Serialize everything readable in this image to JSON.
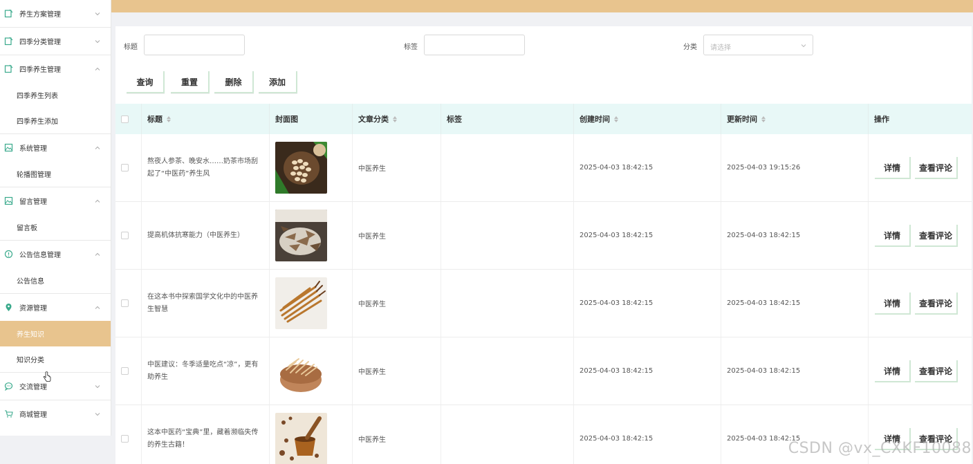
{
  "sidebar": {
    "groups": [
      {
        "label": "养生方案管理",
        "icon": "edit-doc-icon",
        "expanded": false,
        "items": []
      },
      {
        "label": "四季分类管理",
        "icon": "edit-doc-icon",
        "expanded": false,
        "items": []
      },
      {
        "label": "四季养生管理",
        "icon": "edit-doc-icon",
        "expanded": true,
        "items": [
          "四季养生列表",
          "四季养生添加"
        ]
      },
      {
        "label": "系统管理",
        "icon": "image-icon",
        "expanded": true,
        "items": [
          "轮播图管理"
        ]
      },
      {
        "label": "留言管理",
        "icon": "image-icon",
        "expanded": true,
        "items": [
          "留言板"
        ]
      },
      {
        "label": "公告信息管理",
        "icon": "info-icon",
        "expanded": true,
        "items": [
          "公告信息"
        ]
      },
      {
        "label": "资源管理",
        "icon": "location-pin-icon",
        "expanded": true,
        "items": [
          "养生知识",
          "知识分类"
        ]
      },
      {
        "label": "交流管理",
        "icon": "chat-icon",
        "expanded": false,
        "items": []
      },
      {
        "label": "商城管理",
        "icon": "cart-icon",
        "expanded": false,
        "items": []
      }
    ],
    "active_item": "养生知识"
  },
  "filters": {
    "title_label": "标题",
    "title_value": "",
    "tag_label": "标签",
    "tag_value": "",
    "category_label": "分类",
    "category_placeholder": "请选择"
  },
  "toolbar": {
    "search": "查询",
    "reset": "重置",
    "delete": "删除",
    "add": "添加"
  },
  "table": {
    "columns": {
      "title": "标题",
      "cover": "封面图",
      "category": "文章分类",
      "tags": "标签",
      "created": "创建时间",
      "updated": "更新时间",
      "actions": "操作"
    },
    "rows": [
      {
        "title": "熬夜人参茶、晚安水……奶茶市场刮起了“中医药”养生风",
        "category": "中医养生",
        "tags": "",
        "created": "2025-04-03 18:42:15",
        "updated": "2025-04-03 19:15:26",
        "cover": "peanuts"
      },
      {
        "title": "提高机体抗寒能力（中医养生）",
        "category": "中医养生",
        "tags": "",
        "created": "2025-04-03 18:42:15",
        "updated": "2025-04-03 18:42:15",
        "cover": "dried-herbs"
      },
      {
        "title": "在这本书中探索国学文化中的中医养生智慧",
        "category": "中医养生",
        "tags": "",
        "created": "2025-04-03 18:42:15",
        "updated": "2025-04-03 18:42:15",
        "cover": "cordyceps"
      },
      {
        "title": "中医建议：冬季适量吃点“凉”，更有助养生",
        "category": "中医养生",
        "tags": "",
        "created": "2025-04-03 18:42:15",
        "updated": "2025-04-03 18:42:15",
        "cover": "herb-bowl"
      },
      {
        "title": "这本中医药“宝典”里，藏着濒临失传的养生古籍！",
        "category": "中医养生",
        "tags": "",
        "created": "2025-04-03 18:42:15",
        "updated": "2025-04-03 18:42:15",
        "cover": "mortar"
      }
    ],
    "detail_label": "详情",
    "comments_label": "查看评论"
  },
  "watermark": "CSDN @vx_CXKF10088",
  "colors": {
    "accent": "#e8c48e",
    "table_header": "#e8f8f7",
    "button_shadow": "#cfe7d4"
  }
}
